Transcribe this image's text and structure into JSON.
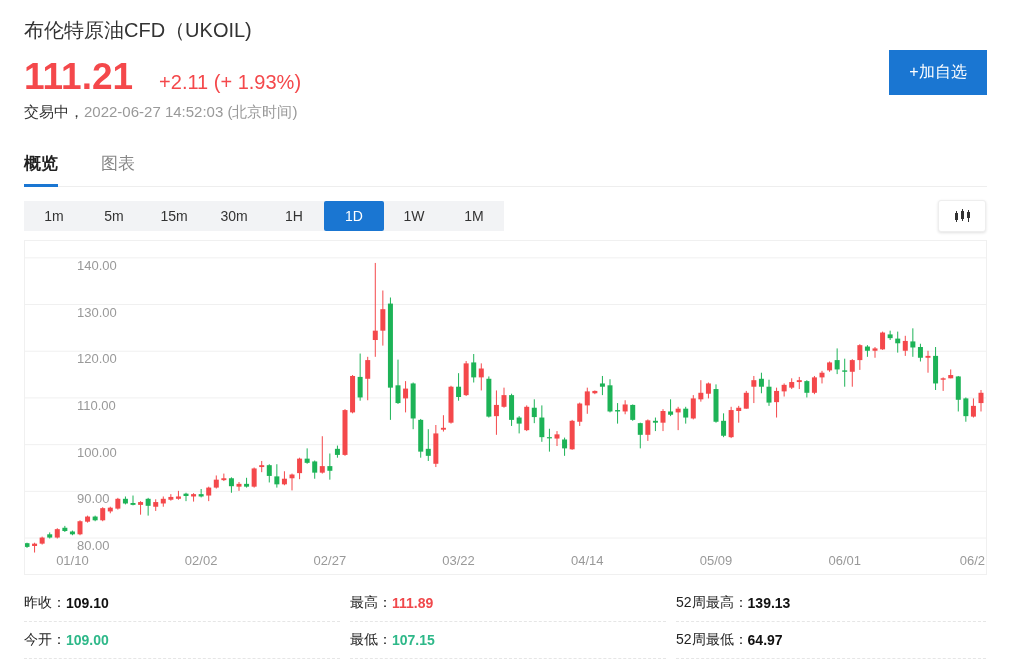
{
  "header": {
    "title": "布伦特原油CFD（UKOIL)",
    "price": "111.21",
    "change": "+2.11 (+ 1.93%)",
    "status": "交易中，",
    "time": "2022-06-27 14:52:03 (北京时间)",
    "watch_button": "+加自选"
  },
  "tabs": [
    {
      "label": "概览",
      "selected": true
    },
    {
      "label": "图表",
      "selected": false
    }
  ],
  "periods": [
    {
      "label": "1m",
      "selected": false
    },
    {
      "label": "5m",
      "selected": false
    },
    {
      "label": "15m",
      "selected": false
    },
    {
      "label": "30m",
      "selected": false
    },
    {
      "label": "1H",
      "selected": false
    },
    {
      "label": "1D",
      "selected": true
    },
    {
      "label": "1W",
      "selected": false
    },
    {
      "label": "1M",
      "selected": false
    }
  ],
  "chart": {
    "chart_data": {
      "type": "candlestick",
      "grid": true,
      "ylim": [
        72.3,
        143.6
      ],
      "yticks": [
        {
          "value": 80,
          "label": "80.00"
        },
        {
          "value": 90,
          "label": "90.00"
        },
        {
          "value": 100,
          "label": "100.00"
        },
        {
          "value": 110,
          "label": "110.00"
        },
        {
          "value": 120,
          "label": "120.00"
        },
        {
          "value": 130,
          "label": "130.00"
        },
        {
          "value": 140,
          "label": "140.00"
        }
      ],
      "categories": [
        null,
        null,
        null,
        null,
        null,
        null,
        "01/10",
        null,
        null,
        null,
        null,
        null,
        null,
        null,
        null,
        null,
        null,
        null,
        null,
        null,
        null,
        null,
        null,
        "02/02",
        null,
        null,
        null,
        null,
        null,
        null,
        null,
        null,
        null,
        null,
        null,
        null,
        null,
        null,
        null,
        null,
        "02/27",
        null,
        null,
        null,
        null,
        null,
        null,
        null,
        null,
        null,
        null,
        null,
        null,
        null,
        null,
        null,
        null,
        "03/22",
        null,
        null,
        null,
        null,
        null,
        null,
        null,
        null,
        null,
        null,
        null,
        null,
        null,
        null,
        null,
        null,
        "04/14",
        null,
        null,
        null,
        null,
        null,
        null,
        null,
        null,
        null,
        null,
        null,
        null,
        null,
        null,
        null,
        null,
        "05/09",
        null,
        null,
        null,
        null,
        null,
        null,
        null,
        null,
        null,
        null,
        null,
        null,
        null,
        null,
        null,
        null,
        "06/01",
        null,
        null,
        null,
        null,
        null,
        null,
        null,
        null,
        null,
        null,
        null,
        null,
        null,
        null,
        null,
        null,
        "06/2",
        null
      ],
      "ohlc": [
        [
          78.9,
          79.0,
          77.9,
          78.1
        ],
        [
          78.3,
          79.0,
          76.9,
          78.8
        ],
        [
          78.8,
          80.3,
          78.6,
          80.1
        ],
        [
          80.8,
          81.2,
          79.9,
          80.1
        ],
        [
          80.1,
          82.1,
          79.9,
          81.9
        ],
        [
          82.2,
          82.6,
          81.3,
          81.5
        ],
        [
          81.4,
          81.6,
          80.6,
          80.8
        ],
        [
          80.8,
          83.8,
          80.6,
          83.6
        ],
        [
          83.5,
          84.8,
          83.3,
          84.6
        ],
        [
          84.6,
          84.8,
          83.6,
          83.8
        ],
        [
          83.8,
          86.6,
          83.6,
          86.4
        ],
        [
          85.7,
          86.7,
          85.3,
          86.5
        ],
        [
          86.3,
          88.6,
          86.1,
          88.4
        ],
        [
          88.4,
          88.9,
          87.2,
          87.4
        ],
        [
          87.5,
          89.1,
          87.0,
          87.1
        ],
        [
          87.1,
          87.9,
          85.0,
          87.7
        ],
        [
          88.4,
          88.6,
          84.8,
          86.9
        ],
        [
          86.7,
          88.3,
          85.8,
          87.7
        ],
        [
          87.4,
          88.9,
          86.7,
          88.4
        ],
        [
          88.2,
          89.4,
          88.0,
          88.8
        ],
        [
          88.4,
          90.1,
          88.2,
          88.9
        ],
        [
          89.5,
          89.7,
          87.9,
          89.0
        ],
        [
          88.9,
          89.6,
          87.8,
          89.4
        ],
        [
          89.4,
          90.5,
          88.7,
          88.9
        ],
        [
          89.1,
          91.0,
          87.9,
          90.8
        ],
        [
          90.8,
          93.4,
          90.6,
          92.5
        ],
        [
          92.4,
          93.8,
          92.2,
          92.8
        ],
        [
          92.8,
          93.0,
          89.7,
          91.1
        ],
        [
          91.0,
          92.0,
          90.1,
          91.6
        ],
        [
          91.6,
          92.9,
          90.8,
          91.0
        ],
        [
          91.0,
          95.1,
          90.8,
          94.9
        ],
        [
          95.2,
          96.5,
          94.1,
          95.6
        ],
        [
          95.6,
          95.8,
          91.9,
          93.3
        ],
        [
          93.2,
          95.8,
          90.8,
          91.5
        ],
        [
          91.5,
          94.3,
          91.3,
          92.7
        ],
        [
          92.8,
          93.8,
          90.2,
          93.6
        ],
        [
          93.9,
          97.2,
          92.6,
          97.0
        ],
        [
          97.0,
          99.2,
          95.9,
          96.1
        ],
        [
          96.4,
          96.6,
          92.7,
          94.0
        ],
        [
          94.0,
          101.8,
          93.8,
          95.4
        ],
        [
          95.4,
          98.1,
          92.5,
          94.4
        ],
        [
          99.1,
          99.8,
          97.2,
          97.8
        ],
        [
          97.8,
          107.6,
          97.6,
          107.4
        ],
        [
          106.9,
          114.9,
          106.7,
          114.7
        ],
        [
          114.5,
          119.5,
          109.4,
          110.1
        ],
        [
          114.1,
          118.8,
          109.5,
          118.1
        ],
        [
          122.4,
          138.9,
          118.8,
          124.4
        ],
        [
          124.4,
          133.0,
          121.2,
          129.0
        ],
        [
          130.2,
          131.5,
          105.3,
          112.2
        ],
        [
          112.7,
          118.2,
          108.7,
          108.9
        ],
        [
          109.9,
          113.6,
          106.9,
          112.0
        ],
        [
          113.1,
          113.3,
          103.3,
          105.6
        ],
        [
          105.3,
          105.5,
          97.2,
          98.5
        ],
        [
          99.1,
          103.3,
          96.5,
          97.6
        ],
        [
          95.9,
          104.2,
          95.2,
          102.4
        ],
        [
          103.2,
          106.3,
          102.8,
          103.6
        ],
        [
          104.7,
          112.6,
          104.5,
          112.4
        ],
        [
          112.4,
          115.3,
          109.4,
          110.2
        ],
        [
          110.6,
          117.9,
          110.4,
          117.4
        ],
        [
          117.6,
          119.4,
          113.3,
          114.4
        ],
        [
          114.4,
          117.4,
          111.6,
          116.3
        ],
        [
          114.1,
          114.6,
          105.8,
          106.0
        ],
        [
          106.1,
          111.6,
          102.1,
          108.5
        ],
        [
          108.1,
          112.2,
          107.9,
          110.6
        ],
        [
          110.6,
          110.9,
          104.0,
          105.3
        ],
        [
          105.8,
          106.1,
          102.4,
          104.5
        ],
        [
          103.1,
          108.4,
          102.9,
          108.1
        ],
        [
          107.9,
          109.7,
          104.6,
          105.9
        ],
        [
          105.8,
          108.4,
          100.6,
          101.6
        ],
        [
          101.6,
          103.4,
          98.5,
          101.4
        ],
        [
          101.3,
          102.9,
          99.7,
          102.2
        ],
        [
          101.1,
          101.5,
          97.6,
          99.2
        ],
        [
          99.0,
          105.3,
          98.9,
          105.1
        ],
        [
          104.9,
          109.0,
          104.0,
          108.8
        ],
        [
          108.4,
          112.2,
          106.6,
          111.4
        ],
        [
          111.0,
          111.6,
          110.8,
          111.5
        ],
        [
          113.1,
          114.7,
          110.6,
          112.4
        ],
        [
          112.7,
          114.0,
          106.9,
          107.1
        ],
        [
          107.4,
          108.9,
          104.5,
          107.1
        ],
        [
          107.1,
          109.5,
          106.5,
          108.6
        ],
        [
          108.5,
          108.6,
          105.1,
          105.3
        ],
        [
          104.6,
          104.7,
          99.2,
          102.1
        ],
        [
          102.1,
          105.4,
          100.8,
          105.2
        ],
        [
          105.1,
          105.8,
          102.9,
          104.7
        ],
        [
          104.7,
          107.6,
          102.9,
          107.2
        ],
        [
          107.1,
          109.7,
          106.1,
          106.4
        ],
        [
          106.9,
          108.1,
          103.1,
          107.7
        ],
        [
          107.7,
          108.1,
          104.5,
          105.8
        ],
        [
          105.6,
          110.6,
          105.4,
          109.9
        ],
        [
          109.7,
          113.8,
          109.2,
          111.1
        ],
        [
          110.9,
          113.3,
          109.9,
          113.1
        ],
        [
          111.9,
          112.9,
          104.7,
          104.9
        ],
        [
          105.1,
          106.7,
          101.6,
          101.9
        ],
        [
          101.6,
          108.1,
          101.4,
          107.4
        ],
        [
          107.2,
          108.3,
          104.7,
          107.9
        ],
        [
          107.7,
          111.5,
          107.7,
          111.1
        ],
        [
          112.4,
          114.7,
          108.9,
          113.8
        ],
        [
          114.1,
          115.4,
          111.0,
          112.4
        ],
        [
          112.4,
          113.9,
          108.3,
          109.0
        ],
        [
          109.1,
          112.2,
          105.8,
          111.5
        ],
        [
          111.4,
          113.1,
          110.3,
          112.8
        ],
        [
          112.2,
          114.2,
          111.9,
          113.4
        ],
        [
          113.4,
          114.5,
          111.9,
          113.8
        ],
        [
          113.6,
          113.8,
          110.1,
          111.1
        ],
        [
          111.1,
          114.7,
          110.8,
          114.4
        ],
        [
          114.4,
          115.8,
          113.1,
          115.4
        ],
        [
          115.9,
          117.8,
          115.6,
          117.6
        ],
        [
          118.1,
          120.6,
          115.1,
          116.1
        ],
        [
          115.9,
          118.4,
          112.4,
          115.6
        ],
        [
          115.6,
          118.3,
          112.4,
          118.1
        ],
        [
          118.1,
          121.5,
          116.0,
          121.3
        ],
        [
          121.0,
          121.3,
          118.8,
          120.1
        ],
        [
          120.1,
          120.9,
          118.6,
          120.6
        ],
        [
          120.4,
          124.2,
          120.3,
          124.0
        ],
        [
          123.6,
          124.4,
          122.4,
          122.8
        ],
        [
          122.7,
          124.2,
          119.7,
          121.7
        ],
        [
          120.1,
          123.3,
          119.0,
          122.2
        ],
        [
          122.1,
          124.9,
          118.8,
          120.8
        ],
        [
          120.9,
          121.6,
          117.8,
          118.6
        ],
        [
          118.6,
          120.1,
          115.4,
          119.0
        ],
        [
          119.0,
          120.9,
          111.7,
          113.1
        ],
        [
          113.9,
          114.4,
          111.5,
          114.2
        ],
        [
          114.2,
          116.1,
          114.2,
          114.9
        ],
        [
          114.6,
          114.7,
          107.1,
          109.6
        ],
        [
          109.9,
          110.1,
          104.9,
          106.1
        ],
        [
          106.0,
          109.9,
          105.8,
          108.3
        ],
        [
          108.9,
          111.7,
          107.1,
          111.1
        ]
      ]
    }
  },
  "stats": [
    {
      "label": "昨收：",
      "value": "109.10",
      "color": "#111111"
    },
    {
      "label": "最高：",
      "value": "111.89",
      "color": "#f0484b"
    },
    {
      "label": "52周最高：",
      "value": "139.13",
      "color": "#111111"
    },
    {
      "label": "今开：",
      "value": "109.00",
      "color": "#2eb889"
    },
    {
      "label": "最低：",
      "value": "107.15",
      "color": "#2eb889"
    },
    {
      "label": "52周最低：",
      "value": "64.97",
      "color": "#111111"
    }
  ]
}
